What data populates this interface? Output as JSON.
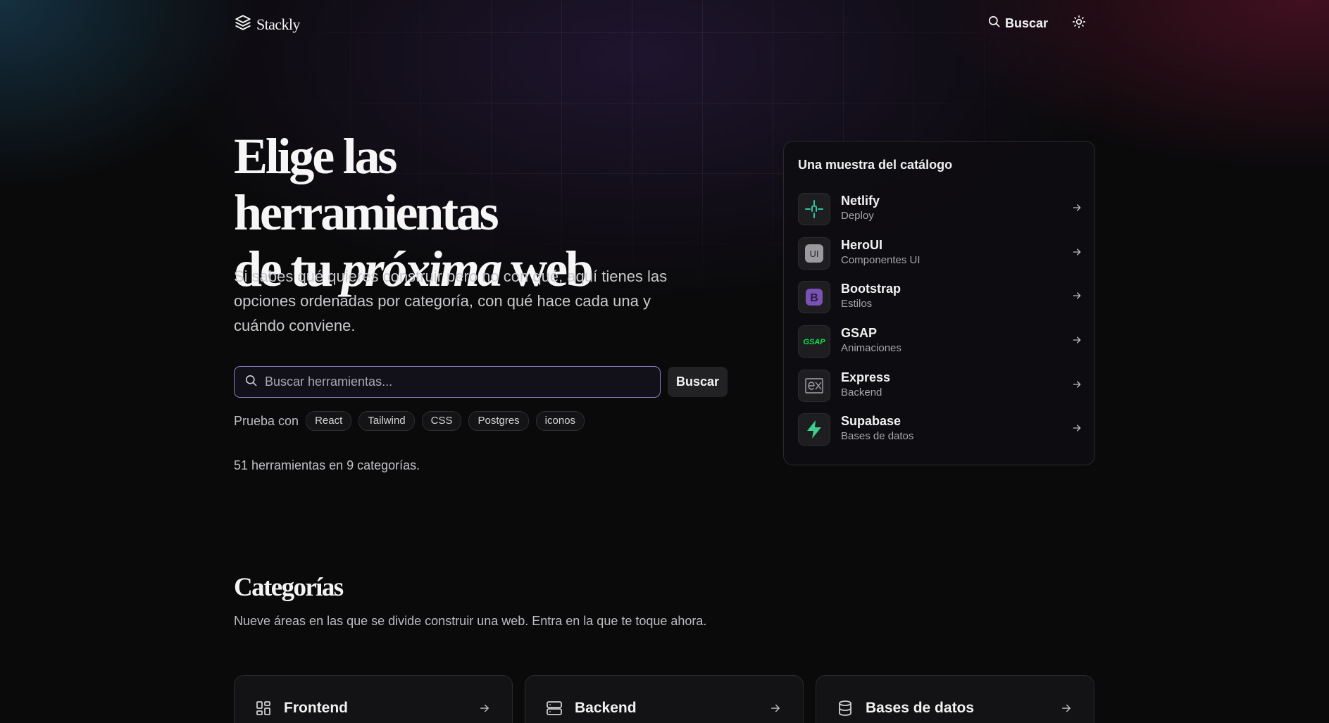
{
  "header": {
    "logo_text": "Stackly",
    "search_label": "Buscar"
  },
  "hero": {
    "title_line1": "Elige las herramientas",
    "title_line2_prefix": "de tu ",
    "title_line2_em": "próxima",
    "title_line2_suffix": " web",
    "subtitle": "Si sabes qué quieres construir pero no con qué, aquí tienes las opciones ordenadas por categoría, con qué hace cada una y cuándo conviene.",
    "search_placeholder": "Buscar herramientas...",
    "search_value": "",
    "search_button": "Buscar",
    "try_label": "Prueba con",
    "chips": [
      "React",
      "Tailwind",
      "CSS",
      "Postgres",
      "iconos"
    ],
    "count_text": "51 herramientas en 9 categorías."
  },
  "catalog": {
    "title": "Una muestra del catálogo",
    "items": [
      {
        "name": "Netlify",
        "category": "Deploy",
        "icon": "netlify-icon"
      },
      {
        "name": "HeroUI",
        "category": "Componentes UI",
        "icon": "heroui-icon"
      },
      {
        "name": "Bootstrap",
        "category": "Estilos",
        "icon": "bootstrap-icon"
      },
      {
        "name": "GSAP",
        "category": "Animaciones",
        "icon": "gsap-icon"
      },
      {
        "name": "Express",
        "category": "Backend",
        "icon": "express-icon"
      },
      {
        "name": "Supabase",
        "category": "Bases de datos",
        "icon": "supabase-icon"
      }
    ]
  },
  "categories": {
    "title": "Categorías",
    "subtitle": "Nueve áreas en las que se divide construir una web. Entra en la que te toque ahora.",
    "cards": [
      {
        "label": "Frontend",
        "icon": "grid-icon"
      },
      {
        "label": "Backend",
        "icon": "server-icon"
      },
      {
        "label": "Bases de datos",
        "icon": "database-icon"
      }
    ]
  },
  "colors": {
    "background": "#0a0a0b",
    "search_border": "#8a7fc2",
    "netlify": "#32c3a6",
    "gsap": "#0ae448",
    "bootstrap": "#7952b3",
    "supabase": "#3ecf8e"
  }
}
